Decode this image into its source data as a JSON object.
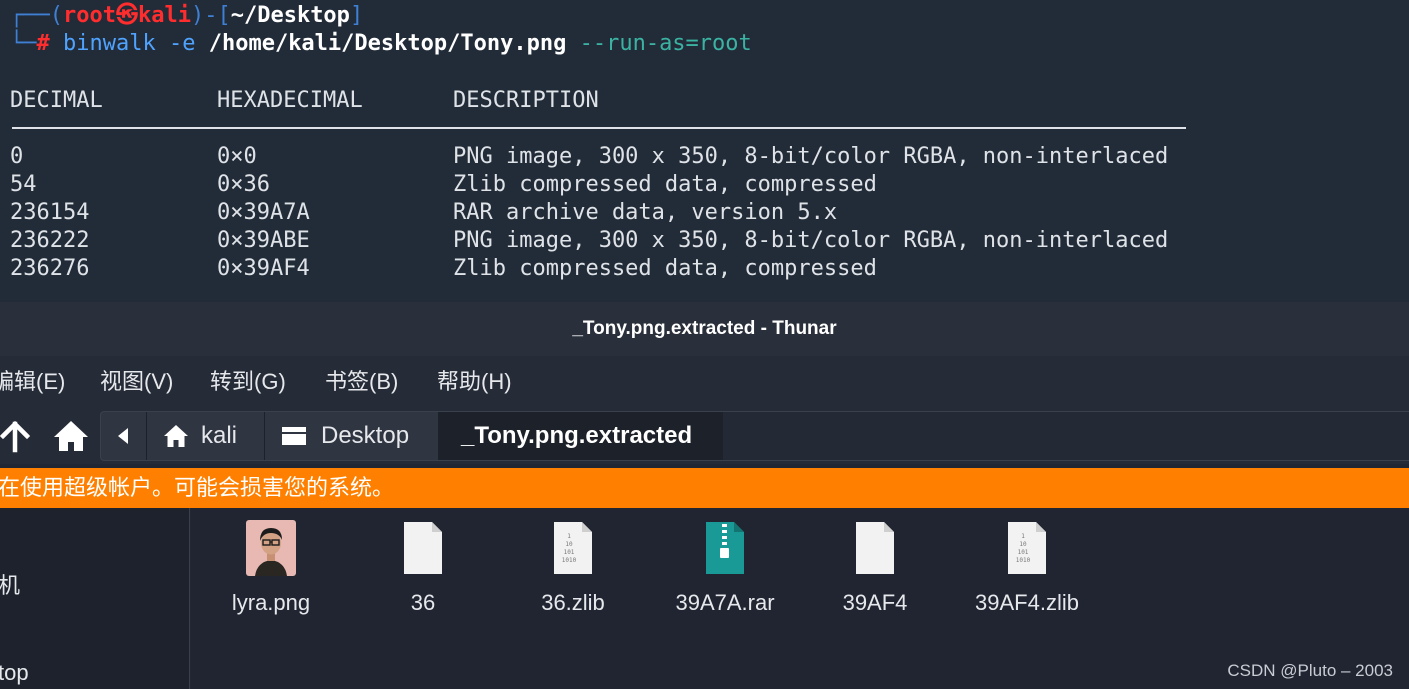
{
  "terminal": {
    "prompt": {
      "user": "root",
      "skull": "㉿",
      "host": "kali",
      "cwd": "~/Desktop",
      "hash": "#",
      "command": "binwalk",
      "flag": "-e",
      "file": "/home/kali/Desktop/Tony.png",
      "option": "--run-as=root"
    },
    "table": {
      "headers": [
        "DECIMAL",
        "HEXADECIMAL",
        "DESCRIPTION"
      ],
      "rows": [
        [
          "0",
          "0×0",
          "PNG image, 300 x 350, 8-bit/color RGBA, non-interlaced"
        ],
        [
          "54",
          "0×36",
          "Zlib compressed data, compressed"
        ],
        [
          "236154",
          "0×39A7A",
          "RAR archive data, version 5.x"
        ],
        [
          "236222",
          "0×39ABE",
          "PNG image, 300 x 350, 8-bit/color RGBA, non-interlaced"
        ],
        [
          "236276",
          "0×39AF4",
          "Zlib compressed data, compressed"
        ]
      ]
    }
  },
  "thunar": {
    "title": "_Tony.png.extracted - Thunar",
    "menu": [
      "编辑(E)",
      "视图(V)",
      "转到(G)",
      "书签(B)",
      "帮助(H)"
    ],
    "breadcrumbs": [
      "kali",
      "Desktop",
      "_Tony.png.extracted"
    ],
    "warning": "在使用超级帐户。可能会损害您的系统。",
    "sidebar": [
      "机",
      "top"
    ],
    "files": [
      {
        "name": "lyra.png",
        "icon": "image-thumbnail-icon"
      },
      {
        "name": "36",
        "icon": "blank-file-icon"
      },
      {
        "name": "36.zlib",
        "icon": "binary-file-icon"
      },
      {
        "name": "39A7A.rar",
        "icon": "archive-file-icon"
      },
      {
        "name": "39AF4",
        "icon": "blank-file-icon"
      },
      {
        "name": "39AF4.zlib",
        "icon": "binary-file-icon"
      }
    ],
    "colors": {
      "warning": "#ff8000",
      "archive": "#1a9a96"
    }
  },
  "watermark": "CSDN @Pluto – 2003"
}
